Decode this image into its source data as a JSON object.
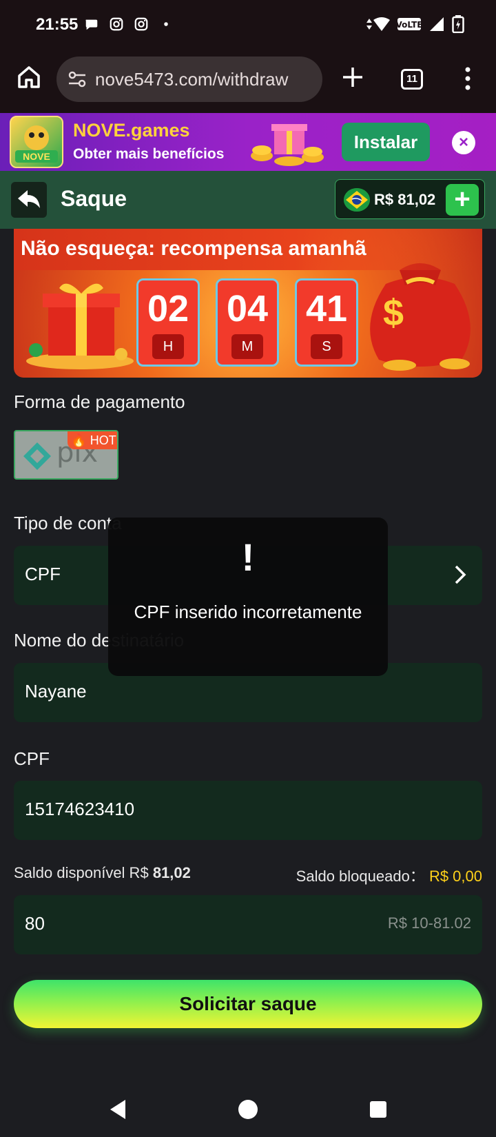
{
  "status_bar": {
    "time": "21:55"
  },
  "browser": {
    "url": "nove5473.com/withdraw",
    "tab_count": "11"
  },
  "promo": {
    "title": "NOVE.games",
    "subtitle": "Obter mais benefícios",
    "install_label": "Instalar",
    "close_label": "×"
  },
  "header": {
    "title": "Saque",
    "balance": "R$ 81,02",
    "add_label": "+"
  },
  "reward": {
    "title": "Não esqueça: recompensa amanhã",
    "timer": [
      {
        "value": "02",
        "unit": "H"
      },
      {
        "value": "04",
        "unit": "M"
      },
      {
        "value": "41",
        "unit": "S"
      }
    ]
  },
  "form": {
    "payment_label": "Forma de pagamento",
    "payment_method": {
      "name": "pix",
      "badge": "HOT"
    },
    "account_type_label": "Tipo de conta",
    "account_type_value": "CPF",
    "recipient_label": "Nome do destinatário",
    "recipient_value": "Nayane",
    "cpf_label": "CPF",
    "cpf_value": "15174623410",
    "saldo_disponivel_label": "Saldo disponível R$",
    "saldo_disponivel_value": "81,02",
    "saldo_bloqueado_label": "Saldo bloqueado：",
    "saldo_bloqueado_value": "R$ 0,00",
    "amount_value": "80",
    "amount_hint": "R$ 10-81.02",
    "submit_label": "Solicitar saque"
  },
  "toast": {
    "icon": "!",
    "message": "CPF inserido incorretamente"
  },
  "colors": {
    "accent_green": "#2dc24d",
    "header_green": "#24513a",
    "field_bg": "#132a1e",
    "yellow": "#ffd21a",
    "toast_bg": "#0a0a0b"
  }
}
